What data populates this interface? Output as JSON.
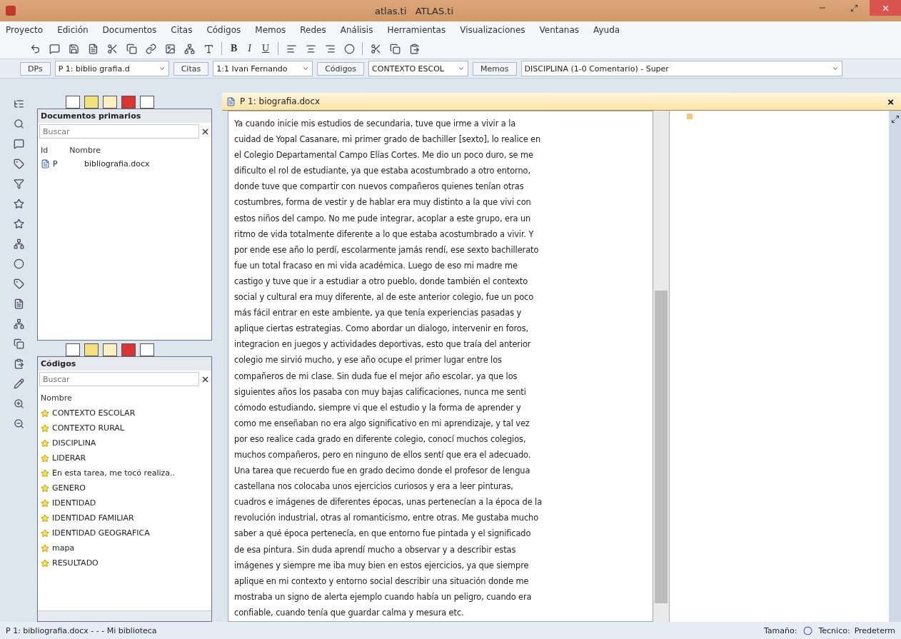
{
  "window": {
    "title": "atlas.ti   ATLAS.ti"
  },
  "menu": [
    "Proyecto",
    "Edición",
    "Documentos",
    "Citas",
    "Códigos",
    "Memos",
    "Redes",
    "Análisis",
    "Herramientas",
    "Visualizaciones",
    "Ventanas",
    "Ayuda"
  ],
  "format_buttons": [
    "B",
    "I",
    "U"
  ],
  "selectors": [
    {
      "button": "DPs",
      "value": "P 1: biblio grafia.d"
    },
    {
      "button": "Citas",
      "value": "1:1 Ivan Fernando"
    },
    {
      "button": "Códigos",
      "value": "CONTEXTO ESCOL"
    },
    {
      "button": "Memos",
      "value": "DISCIPLINA (1-0 Comentario) - Super"
    }
  ],
  "documents_panel": {
    "title": "Documentos primarios",
    "search": {
      "placeholder": "Buscar"
    },
    "columns": [
      "Id",
      "Nombre"
    ],
    "rows": [
      {
        "id": "P",
        "name": "bibliografia.docx"
      }
    ]
  },
  "codes_panel": {
    "title": "Códigos",
    "search": {
      "placeholder": "Buscar"
    },
    "column": "Nombre",
    "items": [
      "CONTEXTO ESCOLAR",
      "CONTEXTO RURAL",
      "DISCIPLINA",
      "LIDERAR",
      "En esta tarea, me tocó realiza..",
      "GENERO",
      "IDENTIDAD",
      "IDENTIDAD FAMILIAR",
      "IDENTIDAD GEOGRAFICA",
      "mapa",
      "RESULTADO"
    ]
  },
  "document": {
    "title": "P 1: biografia.docx",
    "close": "×",
    "text": "Ya cuando inicie mis estudios de secundaria, tuve que irme a vivir a la\ncuidad de Yopal Casanare, mi primer grado de bachiller [sexto], lo realice en\nel Colegio  Departamental Campo Elías Cortes. Me dio un poco duro, se me\ndificulto el rol de estudiante,  ya que estaba acostumbrado a otro entorno,\ndonde tuve que compartir con nuevos compañeros quienes tenían otras\ncostumbres, forma de vestir y de hablar era muy distinto a la que vivi con\nestos niños del campo. No me pude integrar, acoplar a este grupo, era un\nritmo de vida totalmente diferente a lo que estaba acostumbrado a vivir. Y\npor ende ese año lo  perdí, escolarmente jamás rendí, ese sexto bachillerato\nfue un total fracaso en mi vida académica. Luego de eso mi madre me\ncastigo y tuve que ir a estudiar a otro pueblo, donde también el contexto\nsocial y cultural era muy diferente, al de este anterior colegio, fue un poco\nmás fácil entrar en este ambiente, ya que tenía experiencias pasadas y\naplique ciertas estrategias. Como abordar un dialogo, intervenir en foros,\nintegracion en juegos y actividades deportivas, esto que traía del anterior\ncolegio me sirvió mucho, y ese año ocupe el primer lugar entre los\ncompañeros de mi clase. Sin duda fue el mejor año escolar, ya que los\nsiguientes años los pasaba con muy bajas calificaciones, nunca me senti\ncómodo estudiando, siempre vi que el estudio y la forma de aprender y\ncomo me enseñaban no era algo significativo en mi aprendizaje, y tal vez\npor eso realice cada grado en diferente colegio, conocí muchos colegios,\nmuchos compañeros, pero en ninguno de ellos sentí que era el adecuado.\nUna tarea que recuerdo fue en grado decimo donde el profesor de lengua\ncastellana nos colocaba unos ejercicios curiosos y era a leer pinturas,\ncuadros e imágenes de diferentes épocas, unas pertenecían a la época de la\nrevolución industrial, otras al romanticismo, entre otras.  Me gustaba mucho\nsaber a qué época pertenecía, en que entorno fue pintada y el significado\nde esa pintura. Sin duda aprendí mucho a observar y a describir estas\nimágenes y siempre me iba muy bien en estos ejercicios, ya que siempre\naplique en mi contexto y entorno social  describir una situación donde me\nmostraba un signo de alerta ejemplo cuando había un peligro, cuando era\nconfiable, cuando tenía que guardar calma y mesura etc."
  },
  "status_bar": {
    "left": "P 1: bibliografia.docx - - - Mi biblioteca",
    "size_label": "Tamaño:",
    "tech_label": "Tecnico:",
    "tech_value": "Predeterm"
  }
}
